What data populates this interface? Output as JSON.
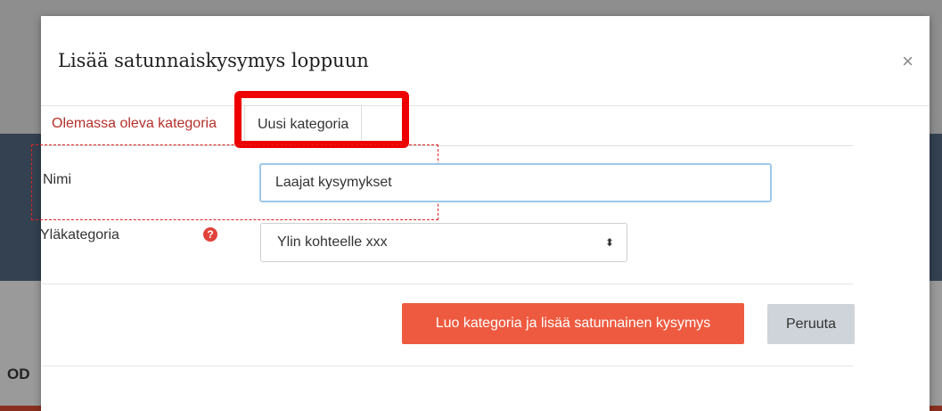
{
  "background": {
    "partial_text": "OD"
  },
  "modal": {
    "title": "Lisää satunnaiskysymys loppuun",
    "close_symbol": "×",
    "close_icon": "close-icon"
  },
  "tabs": [
    {
      "label": "Olemassa oleva kategoria",
      "active": false
    },
    {
      "label": "Uusi kategoria",
      "active": true
    }
  ],
  "form": {
    "name_label": "Nimi",
    "name_value": "Laajat kysymykset",
    "parent_label": "Yläkategoria",
    "help_symbol": "?",
    "help_icon": "question-circle-icon",
    "parent_selected": "Ylin kohteelle xxx",
    "select_arrow": "⬍"
  },
  "actions": {
    "create_label": "Luo kategoria ja lisää satunnainen kysymys",
    "cancel_label": "Peruuta"
  },
  "colors": {
    "accent": "#ee5a3f",
    "tab_link": "#b5302a",
    "highlight": "#ee0000"
  }
}
